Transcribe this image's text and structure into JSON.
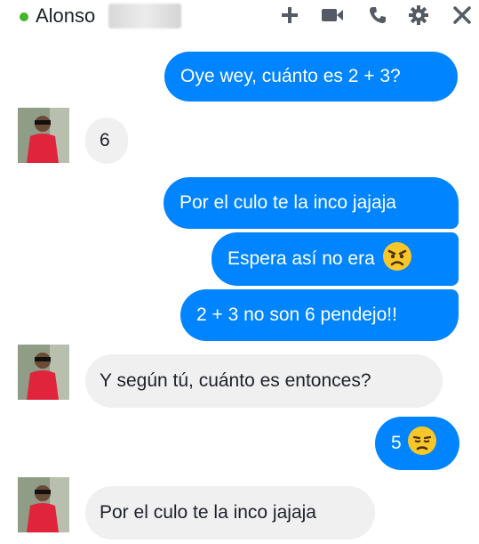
{
  "header": {
    "contact_name": "Alonso",
    "icons": [
      "plus-icon",
      "video-camera-icon",
      "phone-icon",
      "gear-icon",
      "close-icon"
    ],
    "status_color": "#42b72a"
  },
  "messages": [
    {
      "from": "me",
      "text": "Oye wey, cuánto es 2 + 3?"
    },
    {
      "from": "contact",
      "text": "6"
    },
    {
      "from": "me",
      "text": "Por el culo te la inco jajaja"
    },
    {
      "from": "me",
      "text": "Espera así no era",
      "emoji": "angry-face"
    },
    {
      "from": "me",
      "text": "2 + 3 no son 6 pendejo!!"
    },
    {
      "from": "contact",
      "text": "Y según tú, cuánto es entonces?"
    },
    {
      "from": "me",
      "text": "5",
      "emoji": "unamused-face"
    },
    {
      "from": "contact",
      "text": "Por el culo te la inco jajaja"
    }
  ],
  "colors": {
    "outgoing_bubble": "#0084ff",
    "incoming_bubble": "#f1f0f0"
  }
}
